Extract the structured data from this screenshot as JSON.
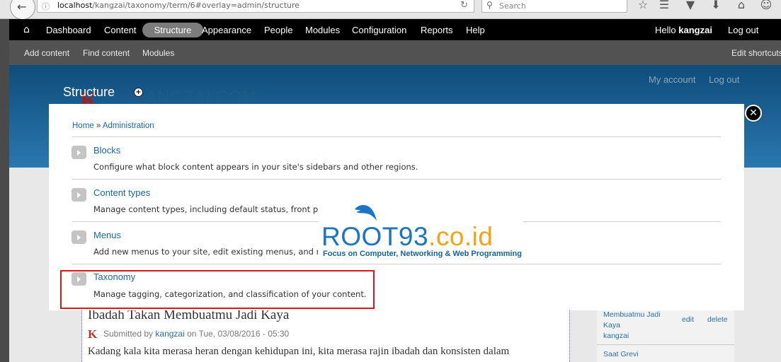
{
  "browser": {
    "url_host": "localhost",
    "url_path": "/kangzai/taxonomy/term/6#overlay=admin/structure",
    "search_placeholder": "Search"
  },
  "toolbar": {
    "items": [
      "Dashboard",
      "Content",
      "Structure",
      "Appearance",
      "People",
      "Modules",
      "Configuration",
      "Reports",
      "Help"
    ],
    "active_item": "Structure",
    "greeting": "Hello",
    "username": "kangzai",
    "logout": "Log out"
  },
  "shortcuts": {
    "items": [
      "Add content",
      "Find content",
      "Modules"
    ],
    "edit_shortcuts": "Edit shortcuts"
  },
  "site": {
    "name": "KANGZAI.COM",
    "logo_letter": "K",
    "my_account": "My account",
    "logout": "Log out"
  },
  "overlay": {
    "page_title": "Structure",
    "breadcrumb": {
      "home": "Home",
      "separator": " » ",
      "admin": "Administration"
    },
    "sections": [
      {
        "title": "Blocks",
        "description": "Configure what block content appears in your site's sidebars and other regions."
      },
      {
        "title": "Content types",
        "description": "Manage content types, including default status, front pa"
      },
      {
        "title": "Menus",
        "description": "Add new menus to your site, edit existing menus, and r"
      },
      {
        "title": "Taxonomy",
        "description": "Manage tagging, categorization, and classification of your content."
      }
    ]
  },
  "watermark": {
    "brand": "ROOT93",
    "domain": ".co.id",
    "tagline": "Focus on Computer, Networking & Web Programming"
  },
  "article": {
    "title": "Ibadah Takan Membuatmu Jadi Kaya",
    "submitted_by": "Submitted by",
    "author": "kangzai",
    "date": "on Tue, 03/08/2016 - 05:30",
    "snippet": "Kadang kala kita merasa heran dengan kehidupan ini, kita merasa rajin ibadah dan konsisten dalam"
  },
  "sidebar": {
    "item_title_lines": [
      "Membuatmu Jadi",
      "Kaya"
    ],
    "item_author": "kangzai",
    "edit": "edit",
    "delete": "delete",
    "next_item": "Saat Grevi"
  },
  "colors": {
    "toolbar_bg": "#000000",
    "shortcut_bg": "#525252",
    "link": "#1a66a6",
    "highlight": "#e0141a"
  }
}
